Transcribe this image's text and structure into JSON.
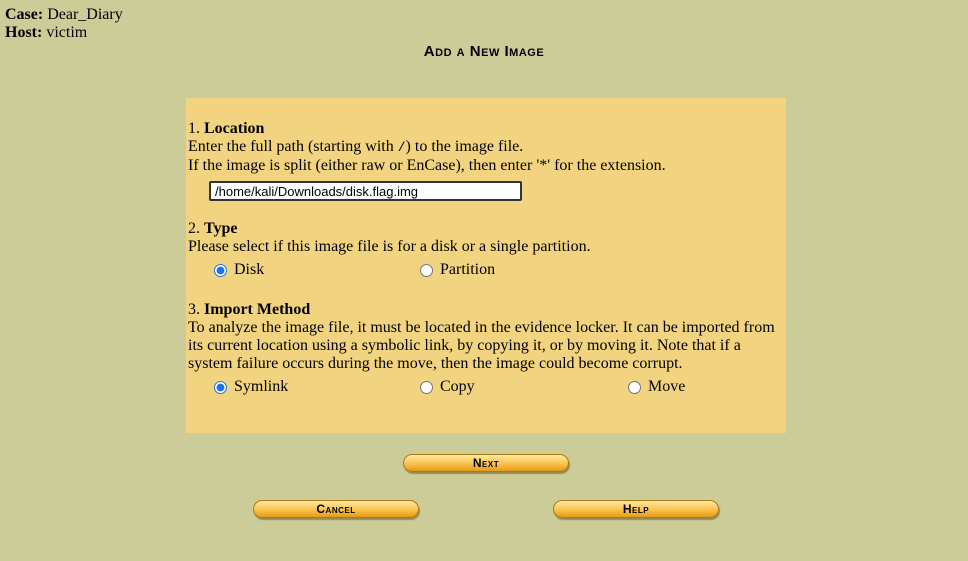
{
  "header": {
    "case_label": "Case:",
    "case_value": "Dear_Diary",
    "host_label": "Host:",
    "host_value": "victim"
  },
  "page_title": "Add a New Image",
  "location": {
    "number": "1.",
    "title": "Location",
    "desc1_before": "Enter the full path (starting with ",
    "desc1_code": "/",
    "desc1_after": ") to the image file.",
    "desc2": "If the image is split (either raw or EnCase), then enter '*' for the extension.",
    "path_value": "/home/kali/Downloads/disk.flag.img"
  },
  "type": {
    "number": "2.",
    "title": "Type",
    "desc": "Please select if this image file is for a disk or a single partition.",
    "options": [
      "Disk",
      "Partition"
    ],
    "selected": "Disk"
  },
  "import": {
    "number": "3.",
    "title": "Import Method",
    "desc": "To analyze the image file, it must be located in the evidence locker. It can be imported from its current location using a symbolic link, by copying it, or by moving it. Note that if a system failure occurs during the move, then the image could become corrupt.",
    "options": [
      "Symlink",
      "Copy",
      "Move"
    ],
    "selected": "Symlink"
  },
  "buttons": {
    "next": "Next",
    "cancel": "Cancel",
    "help": "Help"
  },
  "colors": {
    "page_background": "#cccc99",
    "form_background": "#f2d480",
    "button_orange": "#fbc24a",
    "radio_accent": "#1a73e8"
  }
}
